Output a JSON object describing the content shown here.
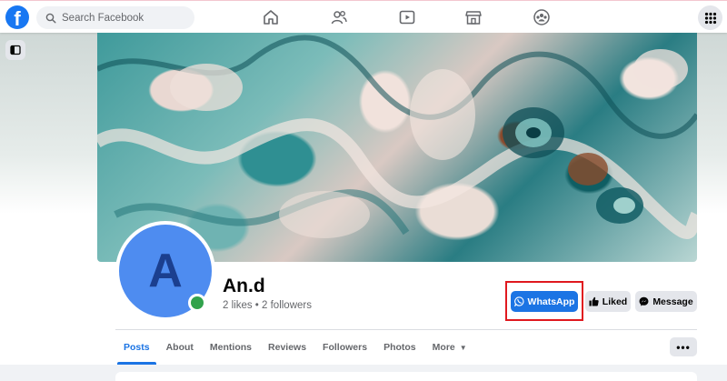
{
  "topbar": {
    "logo_letter": "f",
    "search": {
      "placeholder": "Search Facebook"
    },
    "nav_icons": [
      "home-icon",
      "friends-icon",
      "watch-icon",
      "marketplace-icon",
      "groups-icon"
    ],
    "apps_icon": "menu-grid-icon"
  },
  "sidebar": {
    "toggle_icon": "panel-toggle-icon"
  },
  "profile": {
    "avatar_letter": "A",
    "name": "An.d",
    "stats": "2 likes • 2 followers",
    "online": true
  },
  "actions": {
    "whatsapp_label": "WhatsApp",
    "liked_label": "Liked",
    "message_label": "Message",
    "more_label": "•••"
  },
  "tabs": [
    {
      "label": "Posts",
      "active": true
    },
    {
      "label": "About",
      "active": false
    },
    {
      "label": "Mentions",
      "active": false
    },
    {
      "label": "Reviews",
      "active": false
    },
    {
      "label": "Followers",
      "active": false
    },
    {
      "label": "Photos",
      "active": false
    },
    {
      "label": "More",
      "active": false
    }
  ],
  "colors": {
    "brand_blue": "#1877f2",
    "button_blue": "#1b74e4",
    "online_green": "#31a24c",
    "highlight_red": "#e0191f"
  }
}
